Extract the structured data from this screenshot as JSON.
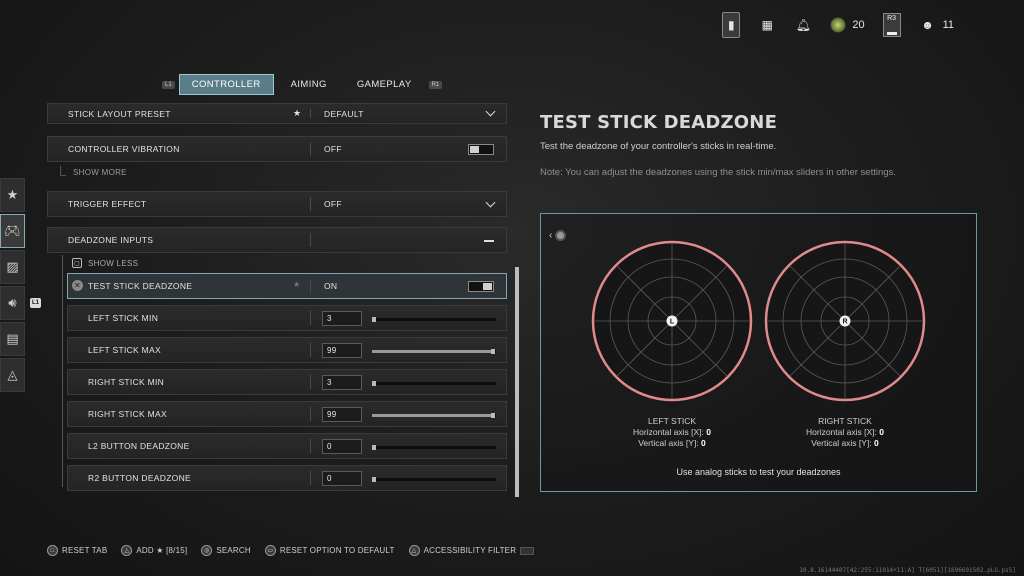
{
  "topbar": {
    "rank_count": "20",
    "party_count": "11",
    "r3_label": "R3"
  },
  "tabs": {
    "left_key": "L1",
    "right_key": "R1",
    "items": [
      {
        "label": "CONTROLLER"
      },
      {
        "label": "AIMING"
      },
      {
        "label": "GAMEPLAY"
      }
    ]
  },
  "l1_key": "L1",
  "settings": {
    "stick_layout_preset": {
      "label": "STICK LAYOUT PRESET",
      "value": "DEFAULT"
    },
    "controller_vibration": {
      "label": "CONTROLLER VIBRATION",
      "value": "OFF"
    },
    "show_more": "SHOW MORE",
    "trigger_effect": {
      "label": "TRIGGER EFFECT",
      "value": "OFF"
    },
    "deadzone_inputs": {
      "label": "DEADZONE INPUTS"
    },
    "show_less": "SHOW LESS",
    "test_stick_deadzone": {
      "label": "TEST STICK DEADZONE",
      "value": "ON"
    },
    "sliders": [
      {
        "label": "LEFT STICK MIN",
        "value": "3",
        "fraction": 0.03
      },
      {
        "label": "LEFT STICK MAX",
        "value": "99",
        "fraction": 0.99
      },
      {
        "label": "RIGHT STICK MIN",
        "value": "3",
        "fraction": 0.03
      },
      {
        "label": "RIGHT STICK MAX",
        "value": "99",
        "fraction": 0.99
      },
      {
        "label": "L2 BUTTON DEADZONE",
        "value": "0",
        "fraction": 0.0
      },
      {
        "label": "R2 BUTTON DEADZONE",
        "value": "0",
        "fraction": 0.0
      }
    ]
  },
  "panel": {
    "title": "TEST STICK DEADZONE",
    "description": "Test the deadzone of your controller's sticks in real-time.",
    "note": "Note: You can adjust the deadzones using the stick min/max sliders in other settings.",
    "left_stick": {
      "title": "LEFT STICK",
      "badge": "L",
      "h_label": "Horizontal axis [X]:",
      "h_value": "0",
      "v_label": "Vertical axis [Y]:",
      "v_value": "0"
    },
    "right_stick": {
      "title": "RIGHT STICK",
      "badge": "R",
      "h_label": "Horizontal axis [X]:",
      "h_value": "0",
      "v_label": "Vertical axis [Y]:",
      "v_value": "0"
    },
    "hint": "Use analog sticks to test your deadzones",
    "ring_color": "#e08b8b"
  },
  "bottom": {
    "reset_tab": "RESET TAB",
    "add": "ADD ★ [8/15]",
    "search": "SEARCH",
    "reset_option": "RESET OPTION TO DEFAULT",
    "accessibility": "ACCESSIBILITY FILTER"
  },
  "build": "10.8.16144407[42:255:11014+11:A] T[6051][1696691502.pLG.ps5]"
}
